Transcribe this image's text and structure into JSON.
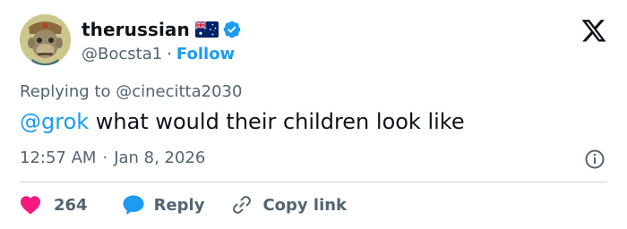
{
  "user": {
    "display_name": "therussian",
    "handle": "@Bocsta1",
    "separator": "·",
    "follow_label": "Follow",
    "flag_icon": "australia-flag-icon",
    "verified_icon": "verified-badge-icon",
    "verified_color": "#1d9bf0"
  },
  "reply_context": {
    "prefix": "Replying to",
    "mention": "@cinecitta2030"
  },
  "tweet": {
    "mention": "@grok",
    "text": " what would their children look like",
    "mention_color": "#1d9bf0"
  },
  "meta": {
    "time": "12:57 AM",
    "separator": "·",
    "date": "Jan 8, 2026"
  },
  "actions": {
    "like_count": "264",
    "like_color": "#f91880",
    "reply_label": "Reply",
    "reply_color": "#1d9bf0",
    "copy_label": "Copy link"
  },
  "colors": {
    "text": "#0f1419",
    "secondary": "#536471",
    "accent": "#1d9bf0",
    "divider": "#cfd9de"
  }
}
